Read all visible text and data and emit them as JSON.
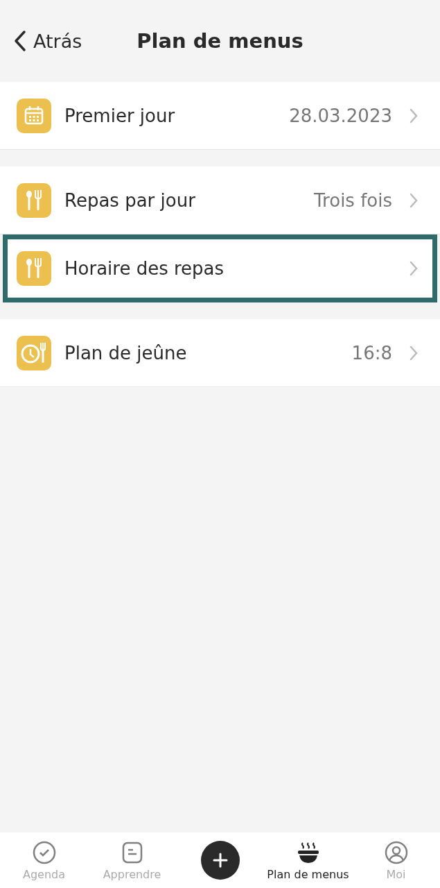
{
  "header": {
    "back": "Atrás",
    "title": "Plan de menus"
  },
  "groups": [
    {
      "rows": [
        {
          "kind": "calendar",
          "label": "Premier jour",
          "value": "28.03.2023",
          "highlighted": false
        }
      ]
    },
    {
      "rows": [
        {
          "kind": "meal",
          "label": "Repas par jour",
          "value": "Trois fois",
          "highlighted": false
        },
        {
          "kind": "meal",
          "label": "Horaire des repas",
          "highlighted": true
        }
      ]
    },
    {
      "rows": [
        {
          "kind": "fasting",
          "label": "Plan de jeûne",
          "value": "16:8",
          "highlighted": false
        }
      ]
    }
  ],
  "tabs": [
    {
      "kind": "agenda",
      "label": "Agenda",
      "selected": false
    },
    {
      "kind": "learn",
      "label": "Apprendre",
      "selected": false
    },
    {
      "kind": "add"
    },
    {
      "kind": "menu",
      "label": "Plan de menus",
      "selected": true
    },
    {
      "kind": "profile",
      "label": "Moi",
      "selected": false
    }
  ]
}
